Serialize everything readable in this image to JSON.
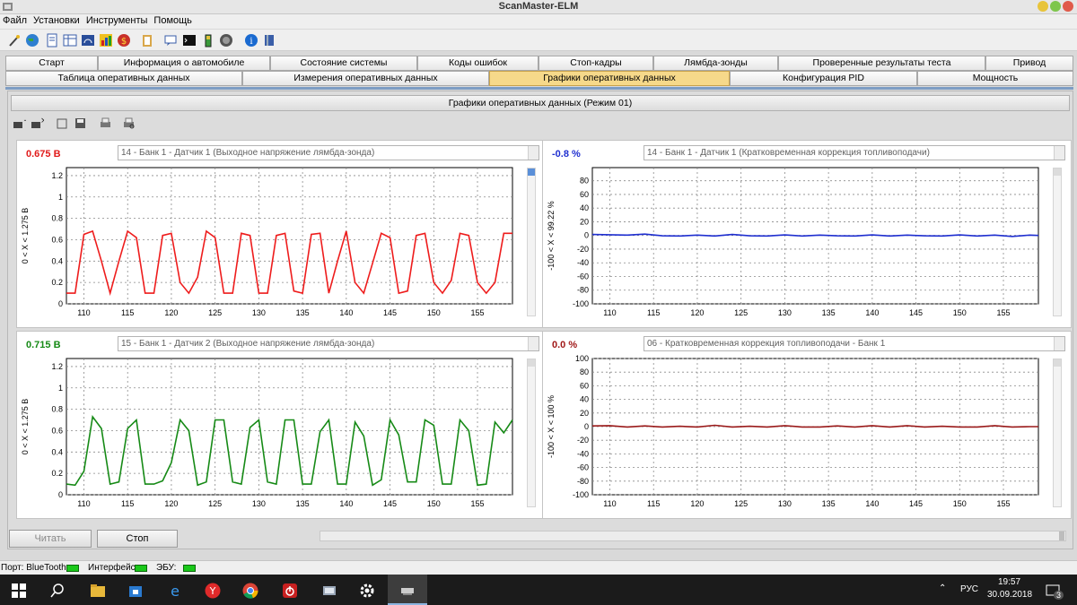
{
  "window": {
    "title": "ScanMaster-ELM"
  },
  "menu": [
    "Файл",
    "Установки",
    "Инструменты",
    "Помощь"
  ],
  "toolbar_icons": [
    "wand-icon",
    "globe-icon",
    "document-icon",
    "table-icon",
    "gauge-icon",
    "chart-icon",
    "dollar-icon",
    "clipboard-icon",
    "chat-icon",
    "terminal-icon",
    "battery-icon",
    "power-icon",
    "info-icon",
    "book-icon"
  ],
  "tabs_top": [
    "Старт",
    "Информация о автомобиле",
    "Состояние системы",
    "Коды ошибок",
    "Стоп-кадры",
    "Лямбда-зонды",
    "Проверенные результаты теста",
    "Привод"
  ],
  "tabs_bottom": [
    "Таблица оперативных данных",
    "Измерения оперативных данных",
    "Графики оперативных данных",
    "Конфигурация PID",
    "Мощность"
  ],
  "active_tab": "Графики оперативных данных",
  "subheader": "Графики оперативных данных (Режим 01)",
  "graphs": [
    {
      "value": "0.675 В",
      "value_color": "#e11b1b",
      "pid": "14 - Банк 1 - Датчик 1 (Выходное напряжение лямбда-зонда)",
      "range_label": "0   < X <   1.275  В",
      "line_color": "#ee1c1c"
    },
    {
      "value": "-0.8 %",
      "value_color": "#1f2fd0",
      "pid": "14 - Банк 1 - Датчик 1 (Кратковременная коррекция топливоподачи)",
      "range_label": "-100   < X <   99.22  %",
      "line_color": "#1f2fd0"
    },
    {
      "value": "0.715 В",
      "value_color": "#168a16",
      "pid": "15 - Банк 1 - Датчик 2 (Выходное напряжение лямбда-зонда)",
      "range_label": "0   < X <   1.275  В",
      "line_color": "#168a16"
    },
    {
      "value": "0.0 %",
      "value_color": "#a01818",
      "pid": "06 - Кратковременная коррекция топливоподачи - Банк 1",
      "range_label": "-100   < X <   100  %",
      "line_color": "#9a1a1a"
    }
  ],
  "chart_data": [
    {
      "type": "line",
      "x_ticks": [
        110,
        115,
        120,
        125,
        130,
        135,
        140,
        145,
        150,
        155
      ],
      "y_ticks": [
        0,
        0.2,
        0.4,
        0.6,
        0.8,
        1,
        1.2
      ],
      "ylim": [
        0,
        1.275
      ],
      "xlim": [
        108,
        159
      ],
      "x": [
        108,
        109,
        110,
        111,
        112,
        113,
        114,
        115,
        116,
        117,
        118,
        119,
        120,
        121,
        122,
        123,
        124,
        125,
        126,
        127,
        128,
        129,
        130,
        131,
        132,
        133,
        134,
        135,
        136,
        137,
        138,
        139,
        140,
        141,
        142,
        143,
        144,
        145,
        146,
        147,
        148,
        149,
        150,
        151,
        152,
        153,
        154,
        155,
        156,
        157,
        158,
        159
      ],
      "y": [
        0.1,
        0.1,
        0.65,
        0.68,
        0.4,
        0.1,
        0.4,
        0.68,
        0.62,
        0.1,
        0.1,
        0.64,
        0.66,
        0.2,
        0.1,
        0.25,
        0.68,
        0.62,
        0.1,
        0.1,
        0.66,
        0.64,
        0.1,
        0.1,
        0.64,
        0.66,
        0.12,
        0.1,
        0.65,
        0.66,
        0.1,
        0.4,
        0.68,
        0.2,
        0.1,
        0.38,
        0.66,
        0.62,
        0.1,
        0.12,
        0.64,
        0.66,
        0.2,
        0.1,
        0.22,
        0.66,
        0.64,
        0.2,
        0.1,
        0.2,
        0.66,
        0.66
      ]
    },
    {
      "type": "line",
      "x_ticks": [
        110,
        115,
        120,
        125,
        130,
        135,
        140,
        145,
        150,
        155
      ],
      "y_ticks": [
        80,
        60,
        40,
        20,
        0,
        -20,
        -40,
        -60,
        -80,
        -100
      ],
      "ylim": [
        -100,
        99.22
      ],
      "xlim": [
        108,
        159
      ],
      "x": [
        108,
        110,
        112,
        114,
        116,
        118,
        120,
        122,
        124,
        126,
        128,
        130,
        132,
        134,
        136,
        138,
        140,
        142,
        144,
        146,
        148,
        150,
        152,
        154,
        156,
        158,
        159
      ],
      "y": [
        1.5,
        1.0,
        0.5,
        2.0,
        -0.5,
        -0.8,
        0.5,
        -0.8,
        1.5,
        -0.5,
        -0.8,
        0.8,
        -0.8,
        0.5,
        -0.5,
        -0.8,
        0.8,
        -0.8,
        0.5,
        -0.5,
        -0.8,
        0.8,
        -0.8,
        0.5,
        -1.5,
        0.5,
        0.0
      ]
    },
    {
      "type": "line",
      "x_ticks": [
        110,
        115,
        120,
        125,
        130,
        135,
        140,
        145,
        150,
        155
      ],
      "y_ticks": [
        0,
        0.2,
        0.4,
        0.6,
        0.8,
        1,
        1.2
      ],
      "ylim": [
        0,
        1.275
      ],
      "xlim": [
        108,
        159
      ],
      "x": [
        108,
        109,
        110,
        111,
        112,
        113,
        114,
        115,
        116,
        117,
        118,
        119,
        120,
        121,
        122,
        123,
        124,
        125,
        126,
        127,
        128,
        129,
        130,
        131,
        132,
        133,
        134,
        135,
        136,
        137,
        138,
        139,
        140,
        141,
        142,
        143,
        144,
        145,
        146,
        147,
        148,
        149,
        150,
        151,
        152,
        153,
        154,
        155,
        156,
        157,
        158,
        159
      ],
      "y": [
        0.1,
        0.09,
        0.22,
        0.73,
        0.62,
        0.1,
        0.12,
        0.62,
        0.7,
        0.1,
        0.1,
        0.13,
        0.3,
        0.7,
        0.6,
        0.09,
        0.12,
        0.7,
        0.7,
        0.12,
        0.1,
        0.63,
        0.7,
        0.12,
        0.1,
        0.7,
        0.7,
        0.1,
        0.1,
        0.59,
        0.7,
        0.1,
        0.1,
        0.68,
        0.55,
        0.09,
        0.14,
        0.7,
        0.56,
        0.12,
        0.12,
        0.7,
        0.65,
        0.1,
        0.1,
        0.7,
        0.6,
        0.09,
        0.1,
        0.68,
        0.58,
        0.7
      ]
    },
    {
      "type": "line",
      "x_ticks": [
        110,
        115,
        120,
        125,
        130,
        135,
        140,
        145,
        150,
        155
      ],
      "y_ticks": [
        100,
        80,
        60,
        40,
        20,
        0,
        -20,
        -40,
        -60,
        -80,
        -100
      ],
      "ylim": [
        -100,
        100
      ],
      "xlim": [
        108,
        159
      ],
      "x": [
        108,
        110,
        112,
        114,
        116,
        118,
        120,
        122,
        124,
        126,
        128,
        130,
        132,
        134,
        136,
        138,
        140,
        142,
        144,
        146,
        148,
        150,
        152,
        154,
        156,
        158,
        159
      ],
      "y": [
        1.0,
        1.5,
        -0.5,
        1.0,
        -0.5,
        0.5,
        -0.5,
        2.0,
        -0.5,
        0.5,
        -0.5,
        1.5,
        -0.5,
        -0.5,
        1.0,
        -0.5,
        1.5,
        -0.5,
        1.5,
        -0.5,
        0.5,
        -0.5,
        -0.5,
        1.5,
        -0.5,
        0.0,
        0.0
      ]
    }
  ],
  "buttons": {
    "read": "Читать",
    "stop": "Стоп"
  },
  "status": {
    "port": "Порт: BlueTooth",
    "interface": "Интерфейс",
    "ecu": "ЭБУ:"
  },
  "taskbar": {
    "lang": "РУС",
    "time": "19:57",
    "date": "30.09.2018",
    "notifications": "3"
  }
}
